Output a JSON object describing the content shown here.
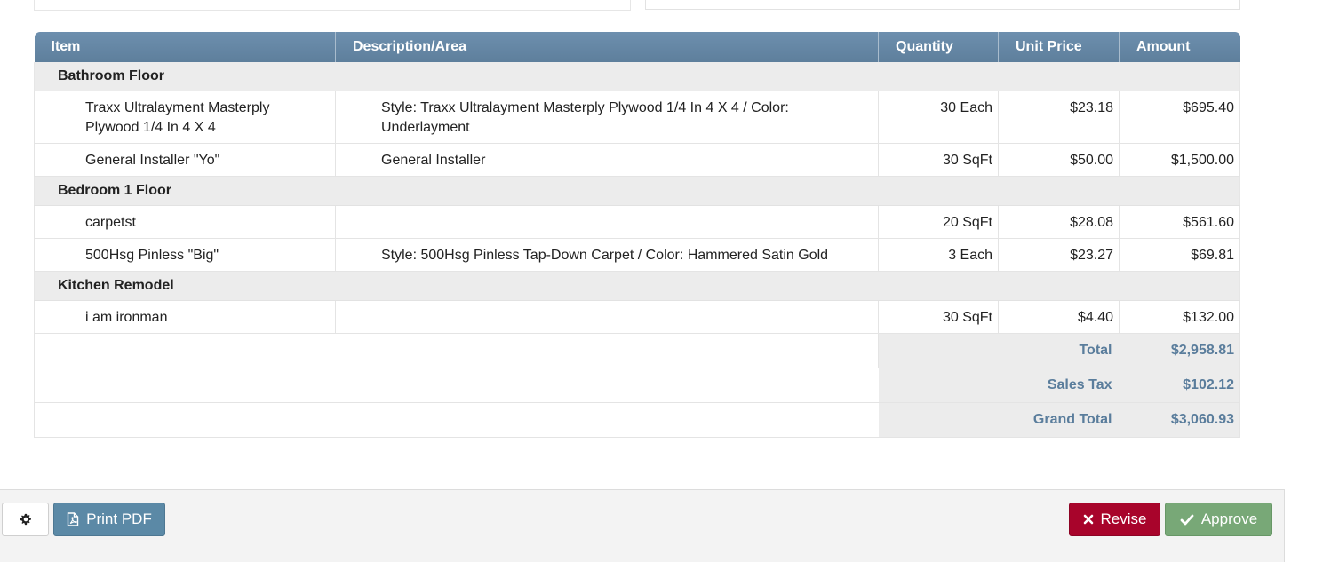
{
  "table": {
    "headers": [
      "Item",
      "Description/Area",
      "Quantity",
      "Unit Price",
      "Amount"
    ],
    "groups": [
      {
        "name": "Bathroom Floor",
        "rows": [
          {
            "item": "Traxx Ultralayment Masterply Plywood 1/4 In 4 X 4",
            "description": "Style: Traxx Ultralayment Masterply Plywood 1/4 In 4 X 4 / Color: Underlayment",
            "quantity": "30 Each",
            "unit_price": "$23.18",
            "amount": "$695.40"
          },
          {
            "item": "General Installer \"Yo\"",
            "description": "General Installer",
            "quantity": "30 SqFt",
            "unit_price": "$50.00",
            "amount": "$1,500.00"
          }
        ]
      },
      {
        "name": "Bedroom 1 Floor",
        "rows": [
          {
            "item": "carpetst",
            "description": "",
            "quantity": "20 SqFt",
            "unit_price": "$28.08",
            "amount": "$561.60"
          },
          {
            "item": "500Hsg Pinless \"Big\"",
            "description": "Style: 500Hsg Pinless Tap-Down Carpet / Color: Hammered Satin Gold",
            "quantity": "3 Each",
            "unit_price": "$23.27",
            "amount": "$69.81"
          }
        ]
      },
      {
        "name": "Kitchen Remodel",
        "rows": [
          {
            "item": "i am ironman",
            "description": "",
            "quantity": "30 SqFt",
            "unit_price": "$4.40",
            "amount": "$132.00"
          }
        ]
      }
    ],
    "totals": [
      {
        "label": "Total",
        "value": "$2,958.81"
      },
      {
        "label": "Sales Tax",
        "value": "$102.12"
      },
      {
        "label": "Grand Total",
        "value": "$3,060.93"
      }
    ]
  },
  "footer": {
    "settings_icon": "gear-icon",
    "print_pdf_label": "Print PDF",
    "print_pdf_icon": "file-pdf-icon",
    "revise_label": "Revise",
    "revise_icon": "close-icon",
    "approve_label": "Approve",
    "approve_icon": "check-icon"
  },
  "colors": {
    "header_bg": "#6686a4",
    "totals_text": "#5a7d9c",
    "print_pdf_bg": "#5b89a6",
    "revise_bg": "#a8042b",
    "approve_bg": "#78a877"
  }
}
